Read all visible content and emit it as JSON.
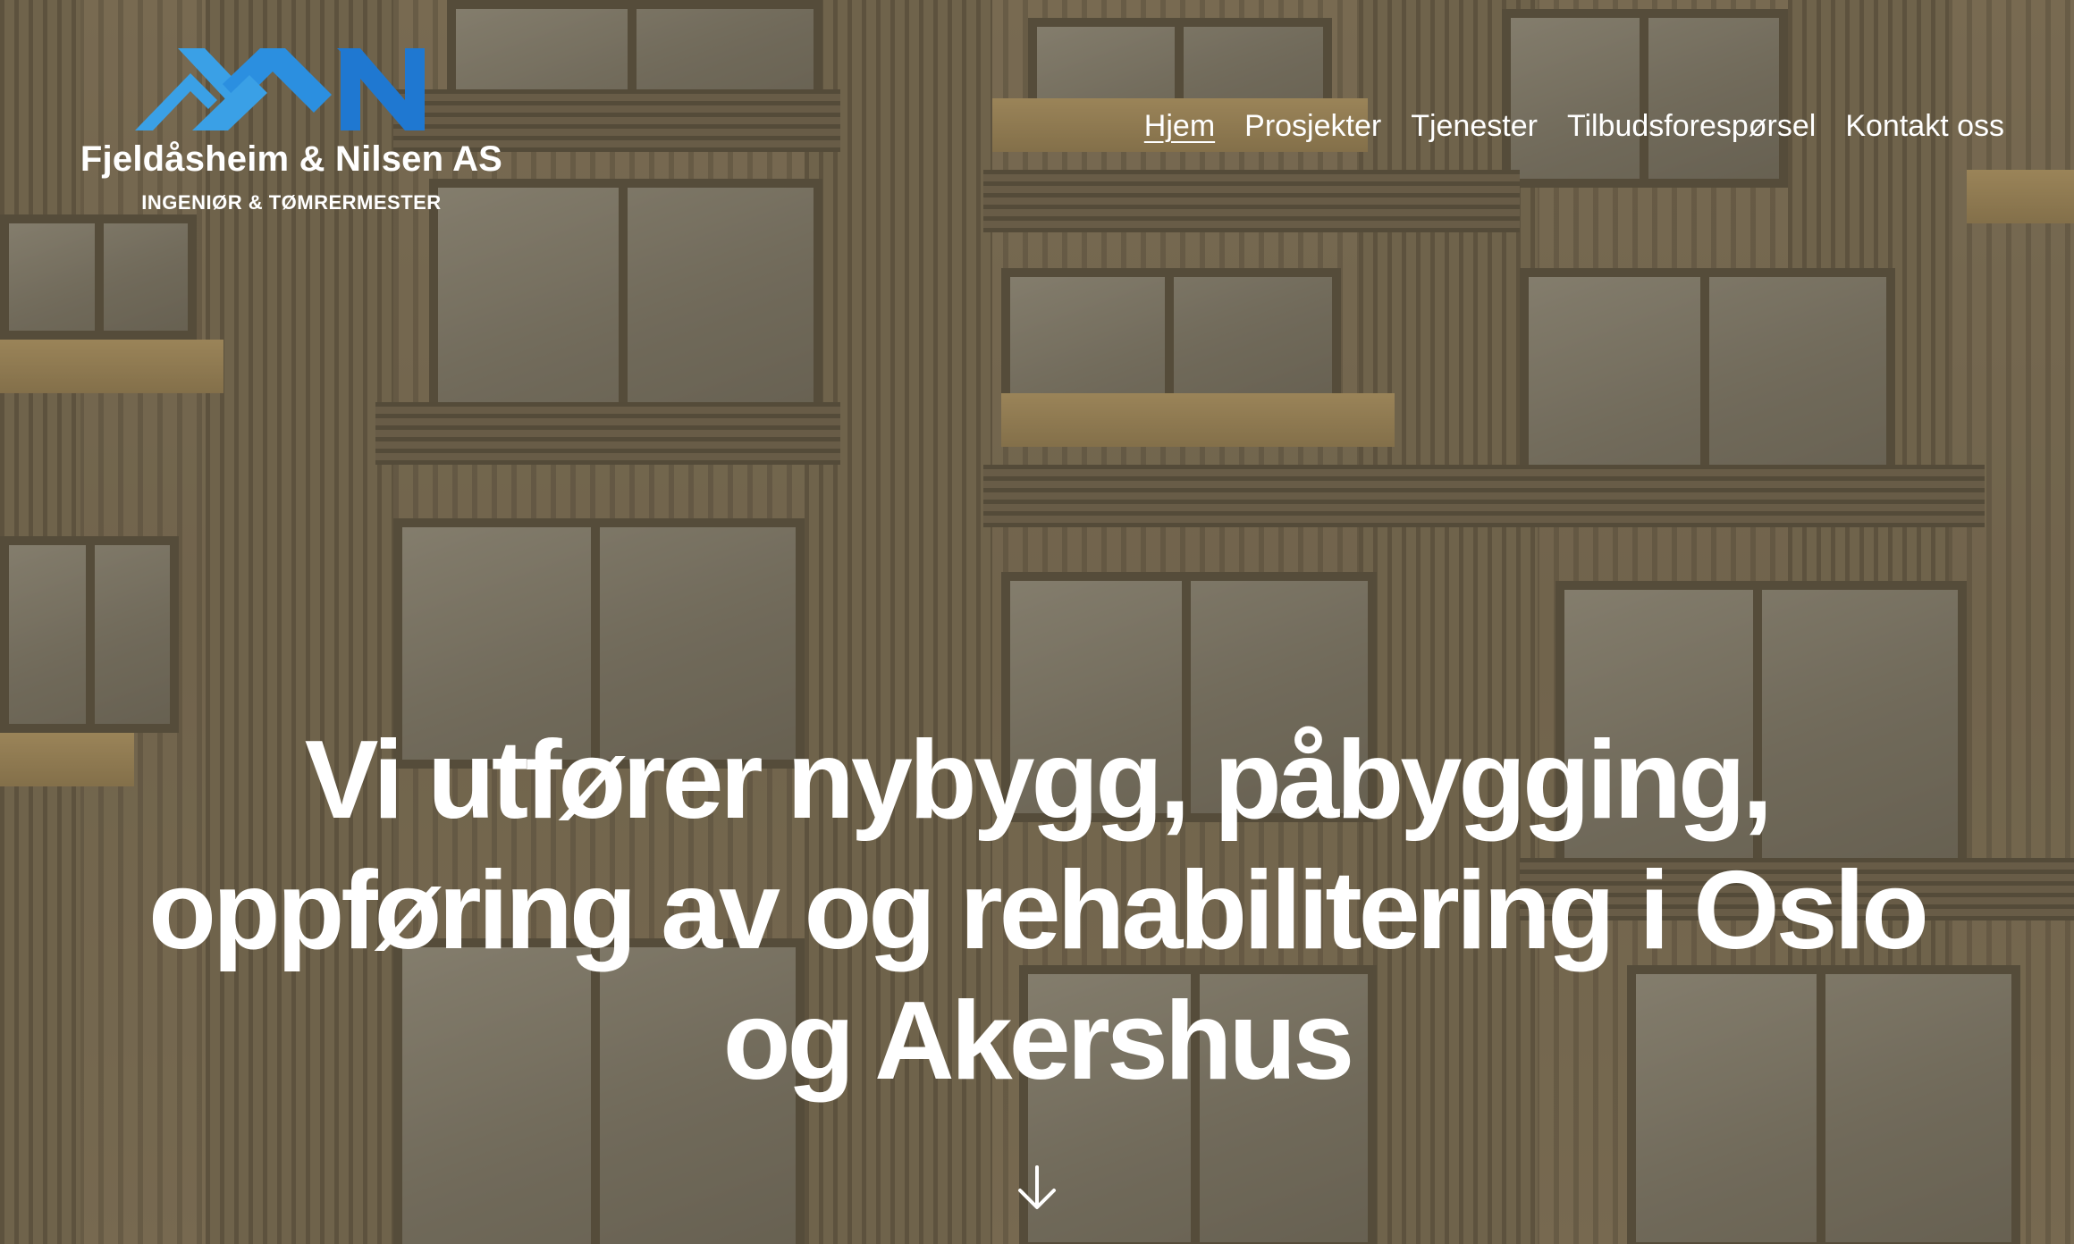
{
  "brand": {
    "name": "Fjeldåsheim & Nilsen AS",
    "tagline": "INGENIØR & TØMRERMESTER",
    "logo_icon": "mountain-n-logo-icon",
    "colors": {
      "logo_light_blue": "#3aa0e6",
      "logo_blue": "#1f78d1"
    }
  },
  "nav": {
    "items": [
      {
        "label": "Hjem",
        "active": true
      },
      {
        "label": "Prosjekter",
        "active": false
      },
      {
        "label": "Tjenester",
        "active": false
      },
      {
        "label": "Tilbudsforespørsel",
        "active": false
      },
      {
        "label": "Kontakt oss",
        "active": false
      }
    ]
  },
  "hero": {
    "headline": "Vi utfører nybygg, påbygging, oppføring av og rehabilitering i Oslo og Akershus",
    "scroll_icon": "arrow-down-icon",
    "background_image": "timber apartment building facade"
  }
}
